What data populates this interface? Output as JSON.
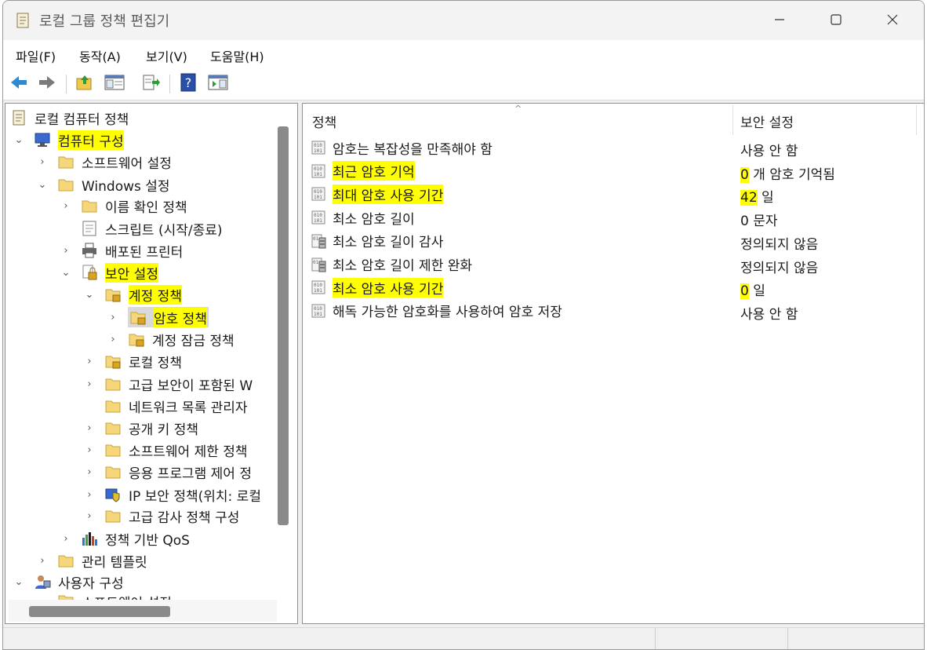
{
  "window": {
    "title": "로컬 그룹 정책 편집기"
  },
  "menu": [
    "파일(F)",
    "동작(A)",
    "보기(V)",
    "도움말(H)"
  ],
  "tree": {
    "root": "로컬 컴퓨터 정책",
    "computer_config": "컴퓨터 구성",
    "software_settings": "소프트웨어 설정",
    "windows_settings": "Windows 설정",
    "name_resolution_policy": "이름 확인 정책",
    "scripts": "스크립트 (시작/종료)",
    "deployed_printers": "배포된 프린터",
    "security_settings": "보안 설정",
    "account_policies": "계정 정책",
    "password_policy": "암호 정책",
    "account_lockout_policy": "계정 잠금 정책",
    "local_policies": "로컬 정책",
    "advanced_firewall": "고급 보안이 포함된 W",
    "network_list_manager": "네트워크 목록 관리자",
    "public_key_policies": "공개 키 정책",
    "software_restriction": "소프트웨어 제한 정책",
    "app_control": "응용 프로그램 제어 정",
    "ipsec": "IP 보안 정책(위치: 로컬",
    "advanced_audit": "고급 감사 정책 구성",
    "qos": "정책 기반 QoS",
    "admin_templates": "관리 템플릿",
    "user_config": "사용자 구성",
    "user_software_settings": "소프트웨어 설정"
  },
  "list": {
    "col_policy": "정책",
    "col_setting": "보안 설정",
    "rows": [
      {
        "policy": "암호는 복잡성을 만족해야 함",
        "value": "",
        "setting": "사용 안 함",
        "highlight": false,
        "icon": "policy-icon"
      },
      {
        "policy": "최근 암호 기억",
        "value": "0",
        "setting": "개 암호 기억됨",
        "highlight": true,
        "icon": "policy-icon"
      },
      {
        "policy": "최대 암호 사용 기간",
        "value": "42",
        "setting": "일",
        "highlight": true,
        "icon": "policy-icon"
      },
      {
        "policy": "최소 암호 길이",
        "value": "",
        "setting": "0 문자",
        "highlight": false,
        "icon": "policy-icon"
      },
      {
        "policy": "최소 암호 길이 감사",
        "value": "",
        "setting": "정의되지 않음",
        "highlight": false,
        "icon": "policy-server-icon"
      },
      {
        "policy": "최소 암호 길이 제한 완화",
        "value": "",
        "setting": "정의되지 않음",
        "highlight": false,
        "icon": "policy-server-icon"
      },
      {
        "policy": "최소 암호 사용 기간",
        "value": "0",
        "setting": "일",
        "highlight": true,
        "icon": "policy-icon"
      },
      {
        "policy": "해독 가능한 암호화를 사용하여 암호 저장",
        "value": "",
        "setting": "사용 안 함",
        "highlight": false,
        "icon": "policy-icon"
      }
    ]
  },
  "colors": {
    "highlight": "#ffff00",
    "selected_bg": "#d9d9d9",
    "folder": "#f5d67a"
  }
}
